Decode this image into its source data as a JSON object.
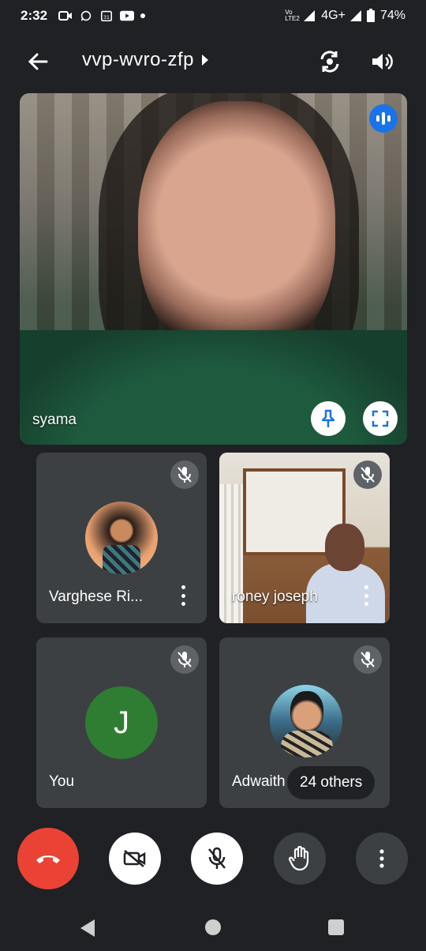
{
  "status_bar": {
    "time": "2:32",
    "network": "4G+",
    "volte": "Vo LTE2",
    "battery": "74%",
    "notification_icons": [
      "video-icon",
      "whatsapp-icon",
      "calendar-icon",
      "youtube-icon",
      "dot-icon"
    ]
  },
  "header": {
    "meeting_code": "vvp-wvro-zfp"
  },
  "main_tile": {
    "participant_name": "syama",
    "speaking": true
  },
  "participants": [
    {
      "name": "Varghese Ri...",
      "muted": true,
      "avatar": "photo"
    },
    {
      "name": "roney joseph",
      "muted": true,
      "avatar": "video"
    },
    {
      "name": "You",
      "muted": true,
      "initial": "J",
      "avatar_color": "#2e7d32"
    },
    {
      "name": "Adwaith",
      "muted": true,
      "avatar": "photo"
    }
  ],
  "others_chip": "24 others",
  "colors": {
    "end_call": "#ea4335",
    "speaking_badge": "#1a73e8",
    "tile_bg": "#3c4043",
    "background": "#202124"
  }
}
